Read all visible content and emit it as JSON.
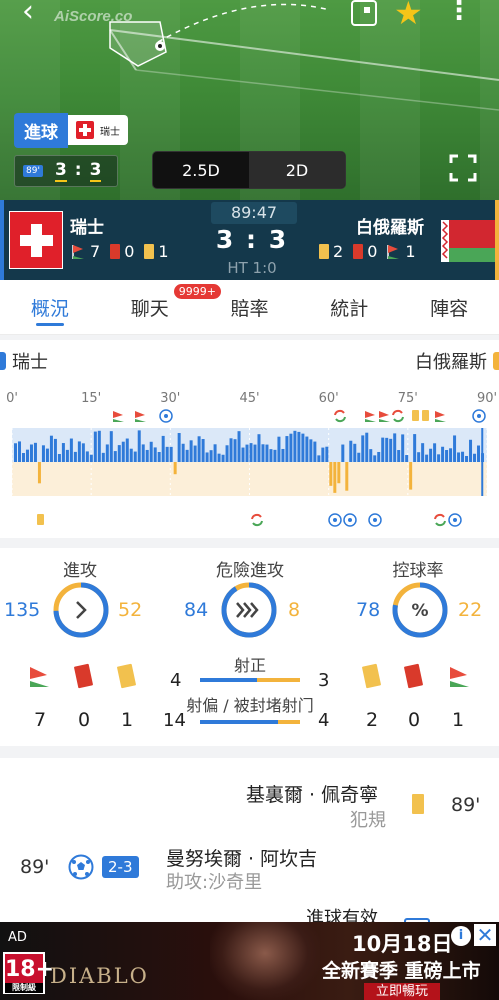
{
  "header": {
    "brand": "AiScore.co",
    "goal_label": "進球",
    "goal_team": "瑞士",
    "mini_minute": "89'",
    "mini_home": "3",
    "mini_away": "3",
    "view_2_5d": "2.5D",
    "view_2d": "2D",
    "icons": [
      "back-icon",
      "picture-in-picture-icon",
      "star-icon",
      "more-icon",
      "fullscreen-icon"
    ]
  },
  "scorebar": {
    "home_name": "瑞士",
    "away_name": "白俄羅斯",
    "clock": "89:47",
    "score": "3 : 3",
    "halftime": "HT 1:0",
    "home_corners": "7",
    "home_red": "0",
    "home_yellow": "1",
    "away_yellow": "2",
    "away_red": "0",
    "away_corners": "1"
  },
  "tabs": [
    {
      "label": "概況",
      "active": true
    },
    {
      "label": "聊天",
      "badge": "9999+"
    },
    {
      "label": "賠率"
    },
    {
      "label": "統計"
    },
    {
      "label": "陣容"
    }
  ],
  "timeline": {
    "home": "瑞士",
    "away": "白俄羅斯",
    "ticks": [
      "0'",
      "15'",
      "30'",
      "45'",
      "60'",
      "75'",
      "90'"
    ],
    "home_color": "#2f7ad9",
    "away_color": "#f3b33c"
  },
  "stats": {
    "attack": {
      "label": "進攻",
      "home": "135",
      "away": "52",
      "icon": "chevron-right-icon"
    },
    "danger": {
      "label": "危險進攻",
      "home": "84",
      "away": "8",
      "icon": "triple-chevron-icon"
    },
    "possession": {
      "label": "控球率",
      "home": "78",
      "away": "22",
      "icon": "percent-icon"
    },
    "shots_on": {
      "label": "射正",
      "home": "4",
      "away": "3"
    },
    "shots_off": {
      "label": "射偏 / 被封堵射门",
      "home": "14",
      "away": "4"
    },
    "home_corners": "7",
    "home_red": "0",
    "home_yellow": "1",
    "away_yellow": "2",
    "away_red": "0",
    "away_corners": "1"
  },
  "events": [
    {
      "name": "基裏爾 · 佩奇寧",
      "sub": "犯規",
      "minute": "89'",
      "side": "away",
      "type": "yellow-card"
    },
    {
      "name": "曼努埃爾 · 阿坎吉",
      "sub": "助攻:沙奇里",
      "minute": "89'",
      "side": "home",
      "type": "goal",
      "score": "2-3"
    },
    {
      "name": "進球有效",
      "side": "away",
      "type": "var"
    }
  ],
  "ad": {
    "tag": "AD",
    "age": "18+",
    "age_sub": "限制級",
    "logo": "DIABLO",
    "date": "10月18日",
    "line": "全新賽季 重磅上市",
    "cta": "立即暢玩",
    "info": "i"
  }
}
